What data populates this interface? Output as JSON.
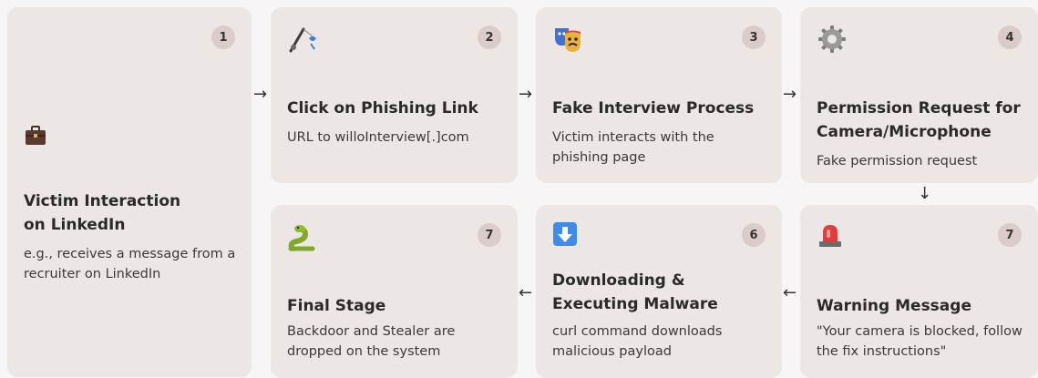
{
  "steps": [
    {
      "num": "1",
      "icon": "briefcase-icon",
      "title": "Victim Interaction on LinkedIn",
      "desc": "e.g., receives a message from a recruiter on LinkedIn"
    },
    {
      "num": "2",
      "icon": "fishing-pole-icon",
      "title": "Click on Phishing Link",
      "desc": "URL to willoInterview[.]com"
    },
    {
      "num": "3",
      "icon": "performing-arts-masks-icon",
      "title": "Fake Interview Process",
      "desc": "Victim interacts with the phishing page"
    },
    {
      "num": "4",
      "icon": "gear-icon",
      "title": "Permission Request for Camera/Microphone",
      "desc": "Fake permission request"
    },
    {
      "num": "7",
      "icon": "siren-icon",
      "title": "Warning Message",
      "desc": "\"Your camera is blocked, follow the fix instructions\""
    },
    {
      "num": "6",
      "icon": "down-arrow-icon",
      "title": "Downloading & Executing Malware",
      "desc": "curl command downloads malicious payload"
    },
    {
      "num": "7",
      "icon": "snake-icon",
      "title": "Final Stage",
      "desc": "Backdoor and Stealer are dropped on the system"
    }
  ],
  "arrows": {
    "right": "→",
    "down": "↓",
    "left": "←"
  }
}
